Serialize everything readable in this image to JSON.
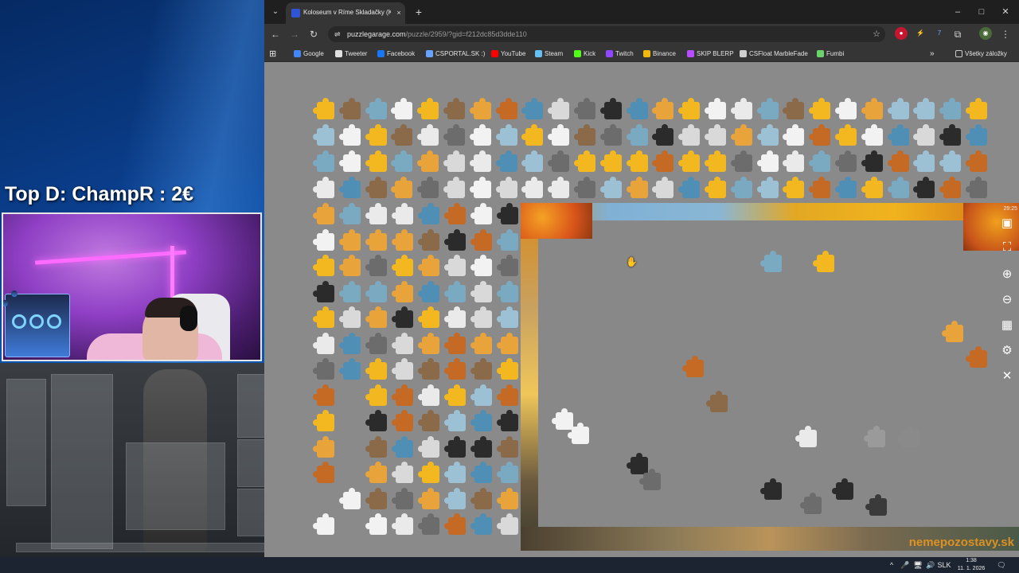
{
  "stream": {
    "donation_text": "Top D: ChampR : 2€"
  },
  "browser": {
    "tab_title": "Koloseum v Ríme Skladačky (K",
    "tab_close": "×",
    "new_tab": "+",
    "tab_list": "⌄",
    "window": {
      "minimize": "–",
      "maximize": "□",
      "close": "✕"
    },
    "nav": {
      "back": "←",
      "forward": "→",
      "reload": "↻",
      "site_info": "⇌",
      "bookmark_star": "☆",
      "extensions": "⧉",
      "menu": "⋮"
    },
    "url": {
      "host": "puzzlegarage.com",
      "path": "/puzzle/2959/?gid=f212dc85d3dde110"
    },
    "apps_icon": "apps-grid-icon",
    "bookmarks": [
      {
        "label": "Google",
        "color": "#4285f4"
      },
      {
        "label": "Tweeter",
        "color": "#e0e0e0"
      },
      {
        "label": "Facebook",
        "color": "#1877f2"
      },
      {
        "label": "CSPORTAL.SK :)",
        "color": "#6aa3ff"
      },
      {
        "label": "YouTube",
        "color": "#ff0000"
      },
      {
        "label": "Steam",
        "color": "#66c0f4"
      },
      {
        "label": "Kick",
        "color": "#53fc18"
      },
      {
        "label": "Twitch",
        "color": "#9146ff"
      },
      {
        "label": "Binance",
        "color": "#f0b90b"
      },
      {
        "label": "SKIP BLERP",
        "color": "#b84cff"
      },
      {
        "label": "CSFloat MarbleFade",
        "color": "#d0d0d0"
      },
      {
        "label": "Fumbi",
        "color": "#6bd36b"
      }
    ],
    "bookmarks_more": "»",
    "all_bookmarks": "Všetky záložky"
  },
  "puzzle": {
    "timer": "29:25",
    "tools": [
      "image-preview-icon",
      "fullscreen-icon",
      "zoom-in-icon",
      "zoom-out-icon",
      "sort-pieces-icon",
      "settings-icon",
      "close-icon"
    ],
    "tool_glyphs": [
      "▣",
      "⛶",
      "⊕",
      "⊖",
      "▦",
      "⚙",
      "✕"
    ],
    "cursor": "✋",
    "piece_palette": [
      "#e8a33a",
      "#7aa9c2",
      "#f2f2f2",
      "#6c6c6c",
      "#d9d9d9",
      "#f3b81f",
      "#8b6a4a",
      "#4f8fb5",
      "#eaeaea",
      "#2b2b2b",
      "#c46a25",
      "#9cc0d4"
    ]
  },
  "watermark": "nemepozostavy.sk",
  "taskbar": {
    "tray_icons": [
      "^",
      "🎤",
      "🖥",
      "🔊",
      "🔋"
    ],
    "language": "SLK",
    "time": "1:38",
    "date": "11. 1. 2026",
    "notifications": "🗨"
  }
}
